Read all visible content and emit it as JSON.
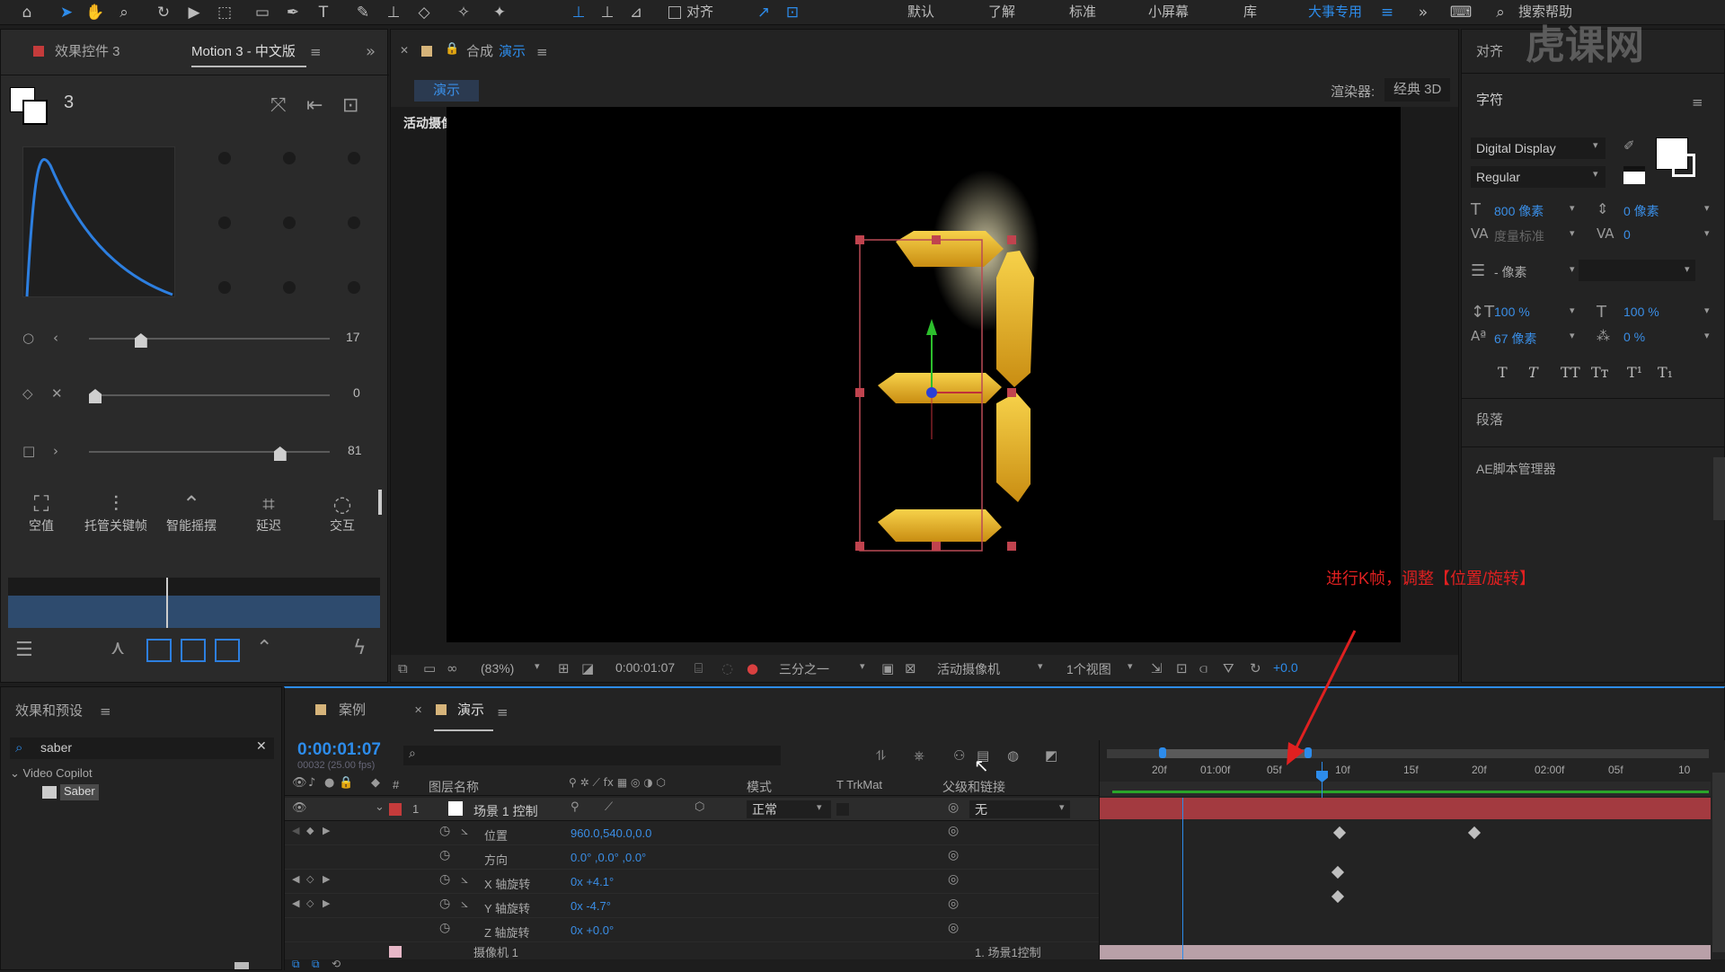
{
  "toolbar": {
    "align_label": "对齐",
    "workspaces": [
      "默认",
      "了解",
      "标准",
      "小屏幕",
      "库"
    ],
    "active_workspace": "大事专用",
    "search_placeholder": "搜索帮助"
  },
  "effects_panel": {
    "tab1": "效果控件 3",
    "tab2": "Motion 3 - 中文版",
    "layer_name": "3",
    "sliders": [
      {
        "value": "17",
        "level": 0.2
      },
      {
        "value": "0",
        "level": 0.0
      },
      {
        "value": "81",
        "level": 0.81
      }
    ],
    "tools": [
      "空值",
      "托管关键帧",
      "智能摇摆",
      "延迟",
      "交互"
    ]
  },
  "comp": {
    "tab_label": "合成",
    "tab_name": "演示",
    "sub_tab": "演示",
    "renderer_label": "渲染器:",
    "renderer_value": "经典 3D",
    "camera_label": "活动摄像机"
  },
  "viewer_bar": {
    "zoom": "(83%)",
    "timecode": "0:00:01:07",
    "grid": "三分之一",
    "camera": "活动摄像机",
    "views": "1个视图",
    "exposure": "+0.0"
  },
  "right_panel": {
    "align": "对齐",
    "char": "字符",
    "font_family": "Digital Display",
    "font_style": "Regular",
    "font_size": "800 像素",
    "leading": "0 像素",
    "kerning": "度量标准",
    "tracking": "0",
    "stroke": "- 像素",
    "vscale": "100 %",
    "hscale": "100 %",
    "baseline": "67 像素",
    "tsume": "0 %",
    "paragraph": "段落",
    "script_mgr": "AE脚本管理器"
  },
  "effects_presets": {
    "title": "效果和预设",
    "search_value": "saber",
    "category": "Video Copilot",
    "item": "Saber"
  },
  "timeline": {
    "tab1": "案例",
    "tab2": "演示",
    "timecode": "0:00:01:07",
    "fps": "00032 (25.00 fps)",
    "headers": {
      "num": "#",
      "name": "图层名称",
      "mode": "模式",
      "trk": "T TrkMat",
      "parent": "父级和链接"
    },
    "layer": {
      "num": "1",
      "name": "场景 1 控制",
      "mode": "正常",
      "parent": "无"
    },
    "props": [
      {
        "name": "位置",
        "value": "960.0,540.0,0.0"
      },
      {
        "name": "方向",
        "value": "0.0° ,0.0° ,0.0°"
      },
      {
        "name": "X 轴旋转",
        "value": "0x +4.1°"
      },
      {
        "name": "Y 轴旋转",
        "value": "0x -4.7°"
      },
      {
        "name": "Z 轴旋转",
        "value": "0x +0.0°"
      }
    ],
    "ruler": [
      "20f",
      "01:00f",
      "05f",
      "10f",
      "15f",
      "20f",
      "02:00f",
      "05f",
      "10"
    ],
    "next_layer_parent": "1. 场景1控制",
    "next_layer_name": "摄像机 1"
  },
  "annotation": "进行K帧，调整【位置/旋转】",
  "watermark": "虎课网"
}
